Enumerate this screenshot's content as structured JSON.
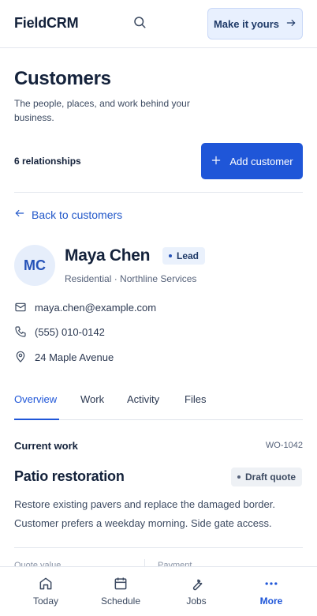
{
  "header": {
    "brand": "FieldCRM",
    "cta_label": "Make it yours",
    "search_icon": "search-icon",
    "cta_icon": "arrow-right-icon"
  },
  "page": {
    "title": "Customers",
    "subtitle": "The people, places, and work behind your business.",
    "relationships_count": "6 relationships",
    "add_button_label": "Add customer"
  },
  "back_link": "Back to customers",
  "customer": {
    "initials": "MC",
    "name": "Maya Chen",
    "status": "Lead",
    "meta": "Residential · Northline Services",
    "email": "maya.chen@example.com",
    "phone": "(555) 010-0142",
    "address": "24 Maple Avenue"
  },
  "tabs": [
    {
      "label": "Overview",
      "active": true
    },
    {
      "label": "Work",
      "active": false
    },
    {
      "label": "Activity",
      "active": false
    },
    {
      "label": "Files",
      "active": false
    }
  ],
  "current_work": {
    "heading": "Current work",
    "id": "WO-1042",
    "title": "Patio restoration",
    "status": "Draft quote",
    "description": "Restore existing pavers and replace the damaged border. Customer prefers a weekday morning. Side gate access.",
    "peek_left": "Quote value",
    "peek_right": "Payment"
  },
  "bottom_nav": [
    {
      "label": "Today",
      "icon": "home-icon",
      "active": false
    },
    {
      "label": "Schedule",
      "icon": "calendar-icon",
      "active": false
    },
    {
      "label": "Jobs",
      "icon": "wrench-icon",
      "active": false
    },
    {
      "label": "More",
      "icon": "more-dots-icon",
      "active": true
    }
  ],
  "colors": {
    "accent": "#1f56d8",
    "text": "#14223b",
    "badge_bg": "#eaf1fc"
  }
}
